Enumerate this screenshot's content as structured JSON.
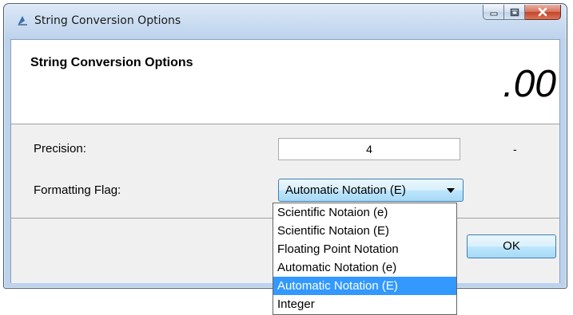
{
  "window": {
    "title": "String Conversion Options",
    "controls": [
      "minimize-icon",
      "maximize-icon",
      "close-icon"
    ]
  },
  "header": {
    "title": "String Conversion Options",
    "glyph": ".00"
  },
  "form": {
    "precision_label": "Precision:",
    "precision_value": "4",
    "precision_suffix": "-",
    "flag_label": "Formatting Flag:",
    "flag_selected": "Automatic Notation (E)"
  },
  "dropdown": {
    "options": [
      "Scientific Notaion (e)",
      "Scientific Notaion (E)",
      "Floating Point Notation",
      "Automatic Notation (e)",
      "Automatic Notation (E)",
      "Integer"
    ],
    "selected_index": 4
  },
  "buttons": {
    "ok_label": "OK"
  },
  "colors": {
    "highlight": "#3399ff",
    "close_button": "#c4442a"
  }
}
